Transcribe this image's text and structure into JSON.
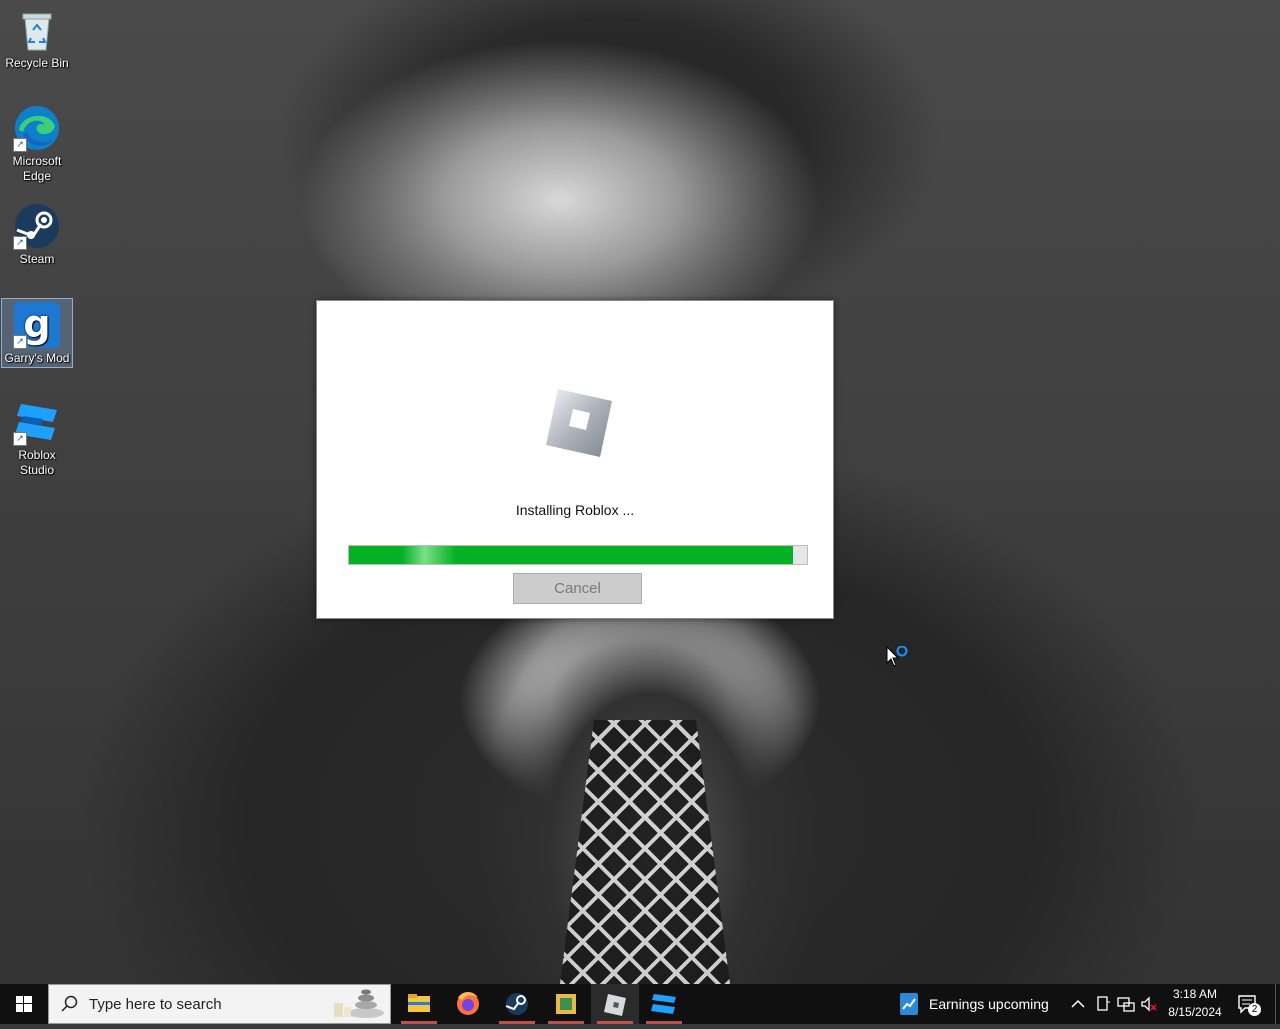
{
  "desktop": {
    "icons": [
      {
        "label": "Recycle Bin",
        "icon": "recycle-bin-icon"
      },
      {
        "label": "Microsoft Edge",
        "icon": "edge-icon"
      },
      {
        "label": "Steam",
        "icon": "steam-icon"
      },
      {
        "label": "Garry's Mod",
        "icon": "garrys-mod-icon"
      },
      {
        "label": "Roblox Studio",
        "icon": "roblox-studio-icon"
      }
    ]
  },
  "installer": {
    "status": "Installing Roblox ...",
    "progress_percent": 97,
    "cancel_label": "Cancel",
    "progress_color": "#06b025"
  },
  "taskbar": {
    "search_placeholder": "Type here to search",
    "apps": [
      "file-explorer-icon",
      "firefox-icon",
      "steam-icon",
      "app-icon",
      "roblox-icon",
      "roblox-studio-icon"
    ],
    "news": "Earnings upcoming",
    "time": "3:18 AM",
    "date": "8/15/2024",
    "notification_count": "2"
  }
}
